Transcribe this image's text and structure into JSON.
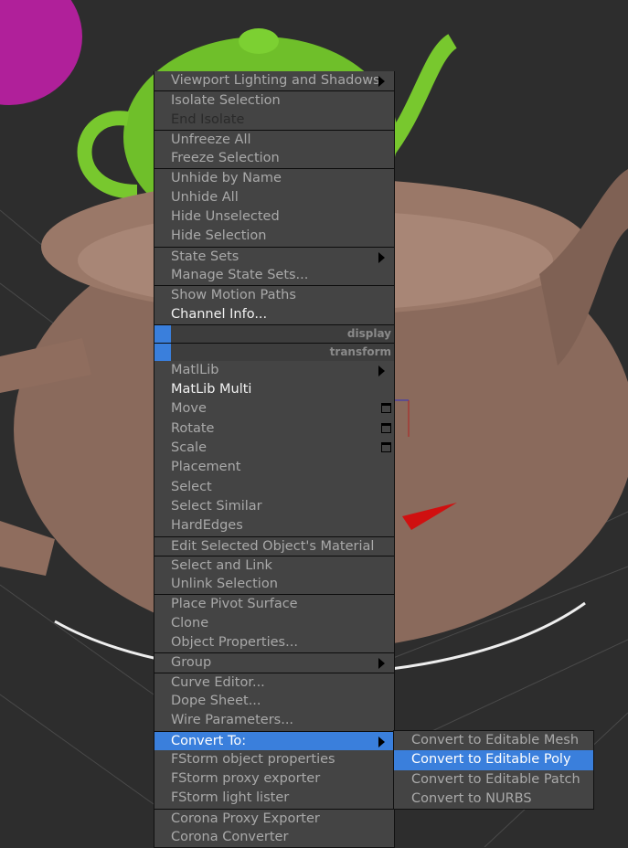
{
  "quad_menu": {
    "display_label": "display",
    "transform_label": "transform",
    "display_items": [
      {
        "label": "Viewport Lighting and Shadows",
        "submenu": true
      },
      {
        "label": "Isolate Selection"
      },
      {
        "label": "End Isolate",
        "disabled": true
      },
      {
        "label": "Unfreeze All"
      },
      {
        "label": "Freeze Selection"
      },
      {
        "label": "Unhide by Name"
      },
      {
        "label": "Unhide All"
      },
      {
        "label": "Hide Unselected"
      },
      {
        "label": "Hide Selection"
      },
      {
        "label": "State Sets",
        "submenu": true
      },
      {
        "label": "Manage State Sets..."
      },
      {
        "label": "Show Motion Paths"
      },
      {
        "label": "Channel Info..."
      }
    ],
    "transform_items": [
      {
        "label": "MatlLib",
        "submenu": true
      },
      {
        "label": "MatLib Multi"
      },
      {
        "label": "Move"
      },
      {
        "label": "Rotate"
      },
      {
        "label": "Scale"
      },
      {
        "label": "Placement"
      },
      {
        "label": "Select"
      },
      {
        "label": "Select Similar"
      },
      {
        "label": "HardEdges"
      },
      {
        "label": "Edit Selected Object's Material"
      },
      {
        "label": "Select and Link"
      },
      {
        "label": "Unlink Selection"
      },
      {
        "label": "Place Pivot Surface"
      },
      {
        "label": "Clone"
      },
      {
        "label": "Object Properties..."
      },
      {
        "label": "Group",
        "submenu": true
      },
      {
        "label": "Curve Editor..."
      },
      {
        "label": "Dope Sheet..."
      },
      {
        "label": "Wire Parameters..."
      },
      {
        "label": "Convert To:",
        "submenu": true,
        "highlighted": true
      },
      {
        "label": "FStorm object properties"
      },
      {
        "label": "FStorm proxy exporter"
      },
      {
        "label": "FStorm light lister"
      },
      {
        "label": "Corona Proxy Exporter"
      },
      {
        "label": "Corona Converter"
      }
    ]
  },
  "convert_submenu": [
    {
      "label": "Convert to Editable Mesh"
    },
    {
      "label": "Convert to Editable Poly",
      "highlighted": true
    },
    {
      "label": "Convert to Editable Patch"
    },
    {
      "label": "Convert to NURBS"
    }
  ],
  "colors": {
    "highlight": "#3a7fdc",
    "menu_bg": "#444444",
    "teapot_brown": "#8a6a5c",
    "teapot_green": "#6fbf2a",
    "teapot_magenta": "#b0209a"
  }
}
